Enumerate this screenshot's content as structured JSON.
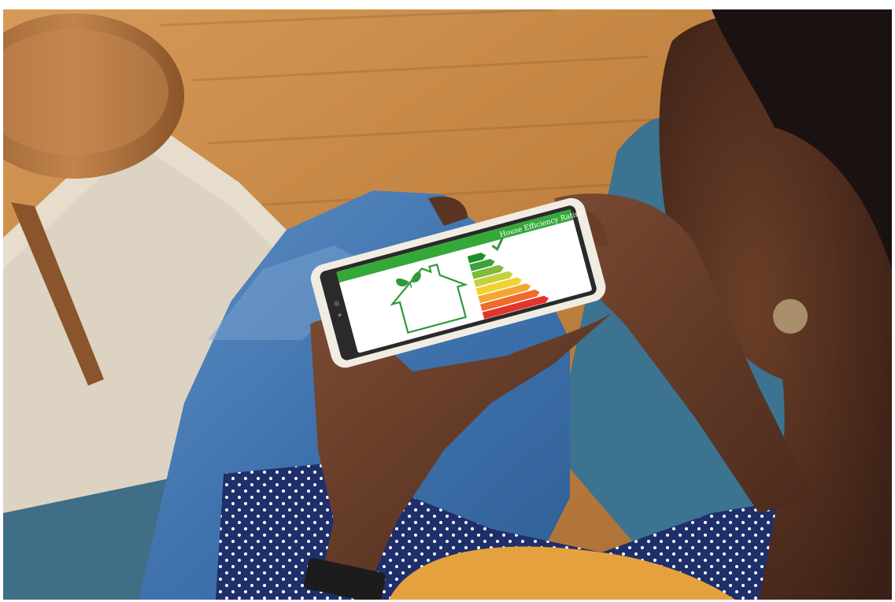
{
  "photo": {
    "phone_screen": {
      "header_text": "House Efficiency Rating",
      "header_color": "#35a83a",
      "icons": [
        "house-outline-icon",
        "leaf-icon",
        "checkmark-icon"
      ],
      "rating_bars": [
        {
          "color": "#1f8f2e"
        },
        {
          "color": "#3aa339"
        },
        {
          "color": "#7dbb3a"
        },
        {
          "color": "#c4d13a"
        },
        {
          "color": "#f2d231"
        },
        {
          "color": "#f5a631"
        },
        {
          "color": "#ee6b2c"
        },
        {
          "color": "#e2342c"
        }
      ]
    }
  }
}
